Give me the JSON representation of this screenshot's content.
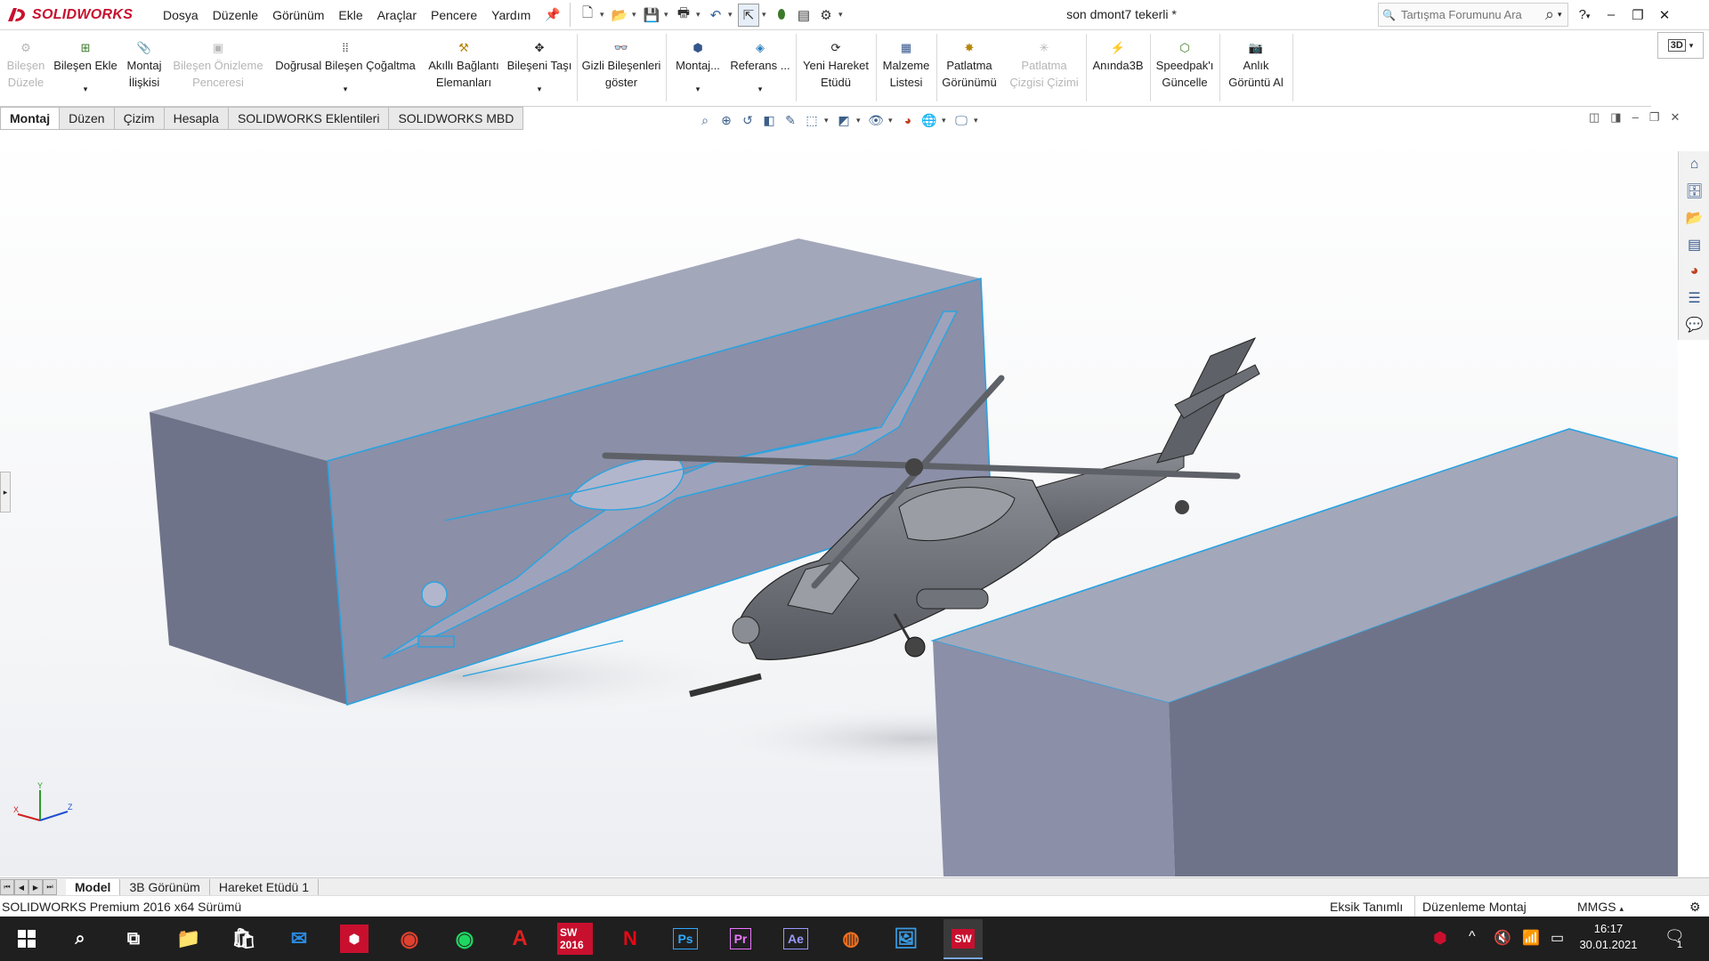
{
  "app": {
    "logo_text": "SOLIDWORKS",
    "document_title": "son dmont7 tekerli *"
  },
  "menu": [
    "Dosya",
    "Düzenle",
    "Görünüm",
    "Ekle",
    "Araçlar",
    "Pencere",
    "Yardım"
  ],
  "search": {
    "placeholder": "Tartışma Forumunu Ara"
  },
  "help_label": "?",
  "ribbon": {
    "bilesen_duzele": [
      "Bileşen",
      "Düzele"
    ],
    "bilesen_ekle": [
      "Bileşen Ekle"
    ],
    "montaj_iliskisi": [
      "Montaj",
      "İlişkisi"
    ],
    "bilesen_onizleme": [
      "Bileşen Önizleme",
      "Penceresi"
    ],
    "dogrusal": [
      "Doğrusal Bileşen Çoğaltma"
    ],
    "akilli": [
      "Akıllı Bağlantı",
      "Elemanları"
    ],
    "bileseni_tasi": [
      "Bileşeni Taşı"
    ],
    "gizli": [
      "Gizli Bileşenleri",
      "göster"
    ],
    "montaj_dd": [
      "Montaj..."
    ],
    "referans": [
      "Referans ..."
    ],
    "yeni_hareket": [
      "Yeni Hareket",
      "Etüdü"
    ],
    "malzeme": [
      "Malzeme",
      "Listesi"
    ],
    "patlatma": [
      "Patlatma",
      "Görünümü"
    ],
    "patlatma_cizgisi": [
      "Patlatma",
      "Çizgisi Çizimi"
    ],
    "aninda3b": [
      "Anında3B"
    ],
    "speedpak": [
      "Speedpak'ı",
      "Güncelle"
    ],
    "anlik": [
      "Anlık",
      "Görüntü Al"
    ],
    "tb3d": "3D"
  },
  "tabs": [
    "Montaj",
    "Düzen",
    "Çizim",
    "Hesapla",
    "SOLIDWORKS Eklentileri",
    "SOLIDWORKS MBD"
  ],
  "triad": {
    "x": "X",
    "y": "Y",
    "z": "Z"
  },
  "bottom_tabs": [
    "Model",
    "3B Görünüm",
    "Hareket Etüdü 1"
  ],
  "status": {
    "version": "SOLIDWORKS Premium 2016 x64 Sürümü",
    "definition": "Eksik Tanımlı",
    "mode": "Düzenleme Montaj",
    "units": "MMGS"
  },
  "taskbar": {
    "apps": [
      "SW 2016",
      "Ps",
      "Pr",
      "Ae",
      "SW"
    ],
    "time": "16:17",
    "date": "30.01.2021",
    "notifications": "1"
  },
  "colors": {
    "solidworks_red": "#c8102e",
    "block_front": "#8b8fa8",
    "block_top": "#a3a7ba",
    "block_side": "#6f7389",
    "edge_highlight": "#2aa3e0",
    "helicopter": "#6b6e74"
  }
}
